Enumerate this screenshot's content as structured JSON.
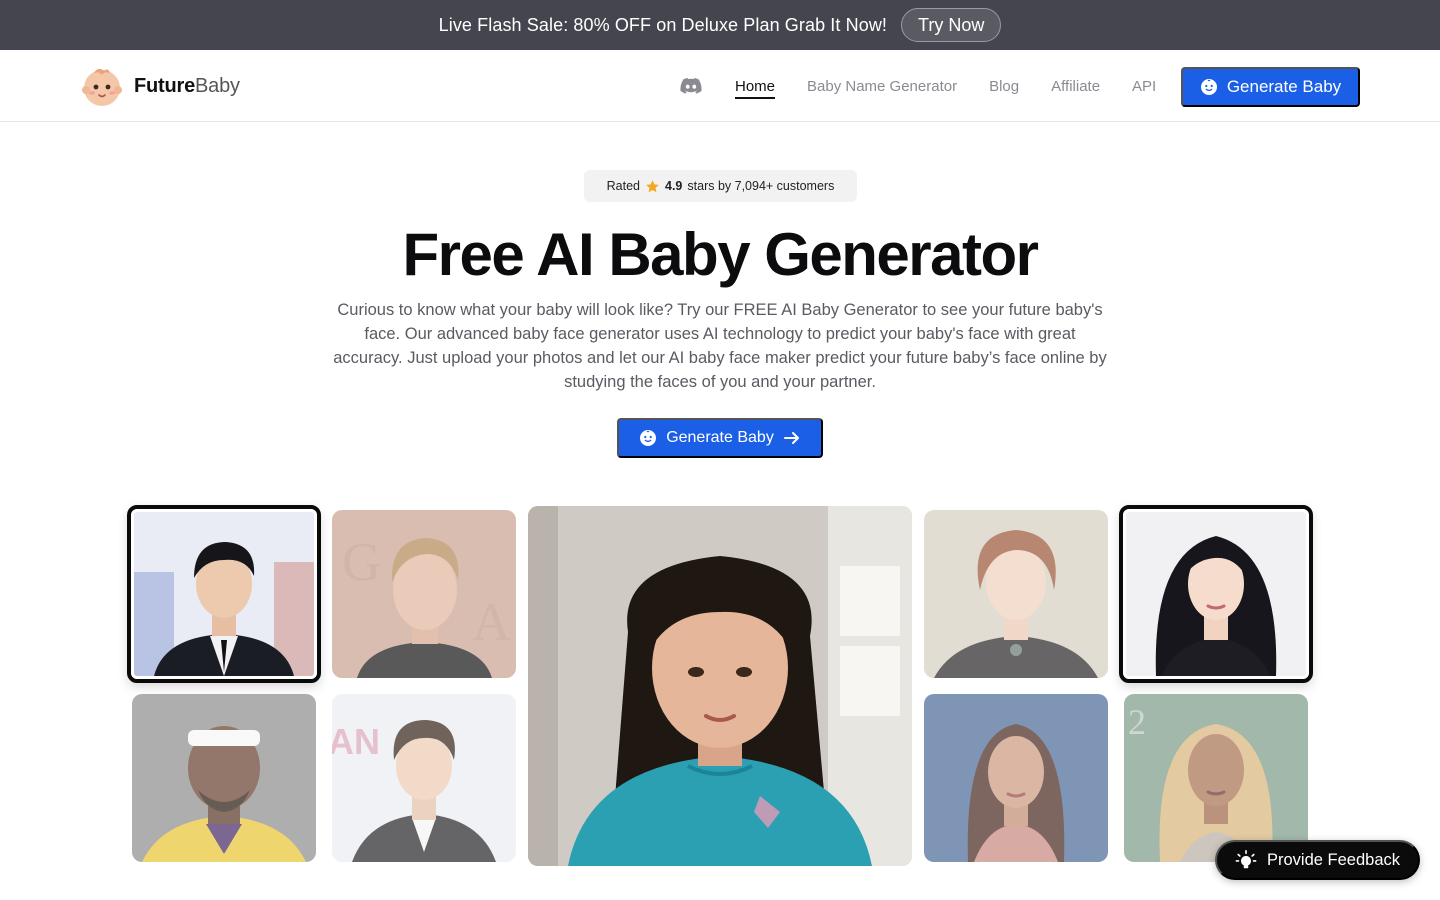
{
  "promo": {
    "text": "Live Flash Sale: 80% OFF on Deluxe Plan Grab It Now!",
    "button": "Try Now"
  },
  "header": {
    "logo_bold": "Future",
    "logo_light": "Baby",
    "nav": [
      "Home",
      "Baby Name Generator",
      "Blog",
      "Affiliate",
      "API"
    ],
    "active_nav": "Home",
    "cta": "Generate Baby"
  },
  "hero": {
    "rated_prefix": "Rated",
    "rating": "4.9",
    "rated_suffix": "stars by 7,094+ customers",
    "title": "Free AI Baby Generator",
    "description": "Curious to know what your baby will look like? Try our FREE AI Baby Generator to see your future baby's face. Our advanced baby face generator uses AI technology to predict your baby's face with great accuracy. Just upload your photos and let our AI baby face maker predict your future baby’s face online by studying the faces of you and your partner.",
    "cta": "Generate Baby"
  },
  "feedback": {
    "label": "Provide Feedback"
  },
  "colors": {
    "primary": "#1a5fe6",
    "promo_bg": "#45454f",
    "star": "#f5a623"
  }
}
